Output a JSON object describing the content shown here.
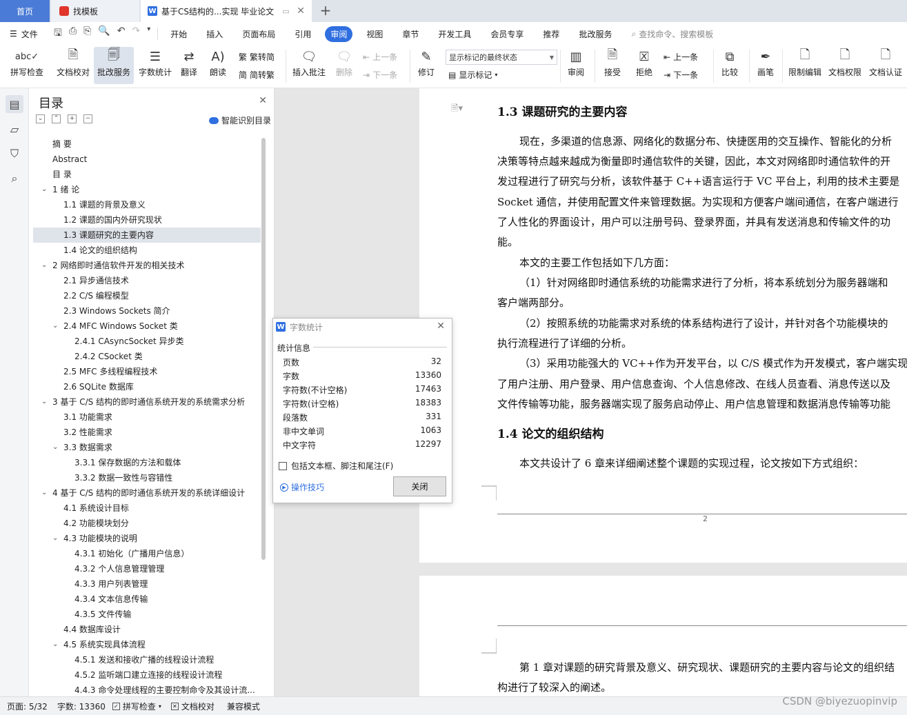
{
  "tabs": {
    "home": "首页",
    "template": "找模板",
    "document": "基于CS结构的...实现 毕业论文"
  },
  "menu": {
    "file": "文件",
    "items": [
      "开始",
      "插入",
      "页面布局",
      "引用",
      "审阅",
      "视图",
      "章节",
      "开发工具",
      "会员专享",
      "推荐",
      "批改服务"
    ],
    "active": "审阅",
    "search_placeholder": "查找命令、搜索模板"
  },
  "ribbon": {
    "spell_check": "拼写检查",
    "doc_proof": "文档校对",
    "review_service": "批改服务",
    "word_count": "字数统计",
    "translate": "翻译",
    "read_aloud": "朗读",
    "to_traditional": "繁转简",
    "to_simplified": "简转繁",
    "insert_comment": "插入批注",
    "delete": "删除",
    "prev_comment": "上一条",
    "next_comment": "下一条",
    "track": "修订",
    "markup_state": "显示标记的最终状态",
    "show_markup": "显示标记",
    "review_pane": "审阅",
    "accept": "接受",
    "reject": "拒绝",
    "prev_change": "上一条",
    "next_change": "下一条",
    "compare": "比较",
    "pen": "画笔",
    "restrict_edit": "限制编辑",
    "doc_rights": "文档权限",
    "doc_cert": "文档认证"
  },
  "toc": {
    "title": "目录",
    "smart_label": "智能识别目录",
    "items": [
      {
        "text": "摘  要",
        "level": 0,
        "chev": ""
      },
      {
        "text": "Abstract",
        "level": 0,
        "chev": ""
      },
      {
        "text": "目  录",
        "level": 0,
        "chev": ""
      },
      {
        "text": "1  绪  论",
        "level": 0,
        "chev": "v"
      },
      {
        "text": "1.1    课题的背景及意义",
        "level": 1,
        "chev": ""
      },
      {
        "text": "1.2    课题的国内外研究现状",
        "level": 1,
        "chev": ""
      },
      {
        "text": "1.3    课题研究的主要内容",
        "level": 1,
        "chev": "",
        "selected": true
      },
      {
        "text": "1.4    论文的组织结构",
        "level": 1,
        "chev": ""
      },
      {
        "text": "2  网络即时通信软件开发的相关技术",
        "level": 0,
        "chev": "v"
      },
      {
        "text": "2.1    异步通信技术",
        "level": 1,
        "chev": ""
      },
      {
        "text": "2.2    C/S 编程模型",
        "level": 1,
        "chev": ""
      },
      {
        "text": "2.3    Windows Sockets 简介",
        "level": 1,
        "chev": ""
      },
      {
        "text": "2.4    MFC Windows Socket 类",
        "level": 1,
        "chev": "v"
      },
      {
        "text": "2.4.1    CAsyncSocket 异步类",
        "level": 2,
        "chev": ""
      },
      {
        "text": "2.4.2    CSocket 类",
        "level": 2,
        "chev": ""
      },
      {
        "text": "2.5    MFC 多线程编程技术",
        "level": 1,
        "chev": ""
      },
      {
        "text": "2.6    SQLite 数据库",
        "level": 1,
        "chev": ""
      },
      {
        "text": "3  基于 C/S 结构的即时通信系统开发的系统需求分析",
        "level": 0,
        "chev": "v"
      },
      {
        "text": "3.1  功能需求",
        "level": 1,
        "chev": ""
      },
      {
        "text": "3.2  性能需求",
        "level": 1,
        "chev": ""
      },
      {
        "text": "3.3  数据需求",
        "level": 1,
        "chev": "v"
      },
      {
        "text": "3.3.1  保存数据的方法和载体",
        "level": 2,
        "chev": ""
      },
      {
        "text": "3.3.2  数据一致性与容错性",
        "level": 2,
        "chev": ""
      },
      {
        "text": "4  基于 C/S 结构的即时通信系统开发的系统详细设计",
        "level": 0,
        "chev": "v"
      },
      {
        "text": "4.1  系统设计目标",
        "level": 1,
        "chev": ""
      },
      {
        "text": "4.2  功能模块划分",
        "level": 1,
        "chev": ""
      },
      {
        "text": "4.3  功能模块的说明",
        "level": 1,
        "chev": "v"
      },
      {
        "text": "4.3.1  初始化（广播用户信息）",
        "level": 2,
        "chev": ""
      },
      {
        "text": "4.3.2  个人信息管理管理",
        "level": 2,
        "chev": ""
      },
      {
        "text": "4.3.3  用户列表管理",
        "level": 2,
        "chev": ""
      },
      {
        "text": "4.3.4  文本信息传输",
        "level": 2,
        "chev": ""
      },
      {
        "text": "4.3.5  文件传输",
        "level": 2,
        "chev": ""
      },
      {
        "text": "4.4  数据库设计",
        "level": 1,
        "chev": ""
      },
      {
        "text": "4.5  系统实现具体流程",
        "level": 1,
        "chev": "v"
      },
      {
        "text": "4.5.1  发送和接收广播的线程设计流程",
        "level": 2,
        "chev": ""
      },
      {
        "text": "4.5.2  监听端口建立连接的线程设计流程",
        "level": 2,
        "chev": ""
      },
      {
        "text": "4.4.3  命令处理线程的主要控制命令及其设计流...",
        "level": 2,
        "chev": ""
      }
    ]
  },
  "document": {
    "heading_13": "1.3    课题研究的主要内容",
    "p1": [
      "现在，多渠道的信息源、网络化的数据分布、快捷医用的交互操作、智能化的分析",
      "决策等特点越来越成为衡量即时通信软件的关键，因此，本文对网络即时通信软件的开",
      "发过程进行了研究与分析，该软件基于 C++语言运行于 VC 平台上，利用的技术主要是",
      "Socket 通信，并使用配置文件来管理数据。为实现和方便客户端间通信，在客户端进行",
      "了人性化的界面设计，用户可以注册号码、登录界面，并具有发送消息和传输文件的功",
      "能。"
    ],
    "p2": "本文的主要工作包括如下几方面：",
    "p3": [
      "（1）针对网络即时通信系统的功能需求进行了分析，将本系统划分为服务器端和",
      "客户端两部分。"
    ],
    "p4": [
      "（2）按照系统的功能需求对系统的体系结构进行了设计，并针对各个功能模块的",
      "执行流程进行了详细的分析。"
    ],
    "p5": [
      "（3）采用功能强大的 VC++作为开发平台，以 C/S 模式作为开发模式，客户端实现",
      "了用户注册、用户登录、用户信息查询、个人信息修改、在线人员查看、消息传送以及",
      "文件传输等功能，服务器端实现了服务启动停止、用户信息管理和数据消息传输等功能"
    ],
    "heading_14": "1.4    论文的组织结构",
    "p6": "本文共设计了 6 章来详细阐述整个课题的实现过程，论文按如下方式组织：",
    "page_number": "2",
    "p7": [
      "第 1 章对课题的研究背景及意义、研究现状、课题研究的主要内容与论文的组织结",
      "构进行了较深入的阐述。"
    ]
  },
  "dialog": {
    "title": "字数统计",
    "group": "统计信息",
    "rows": [
      {
        "label": "页数",
        "value": "32"
      },
      {
        "label": "字数",
        "value": "13360"
      },
      {
        "label": "字符数(不计空格)",
        "value": "17463"
      },
      {
        "label": "字符数(计空格)",
        "value": "18383"
      },
      {
        "label": "段落数",
        "value": "331"
      },
      {
        "label": "非中文单词",
        "value": "1063"
      },
      {
        "label": "中文字符",
        "value": "12297"
      }
    ],
    "checkbox": "包括文本框、脚注和尾注(F)",
    "tips": "操作技巧",
    "close": "关闭"
  },
  "status": {
    "page": "页面: 5/32",
    "words": "字数: 13360",
    "spell": "拼写检查",
    "proof": "文档校对",
    "compat": "兼容模式"
  },
  "watermark": "CSDN @biyezuopinvip"
}
